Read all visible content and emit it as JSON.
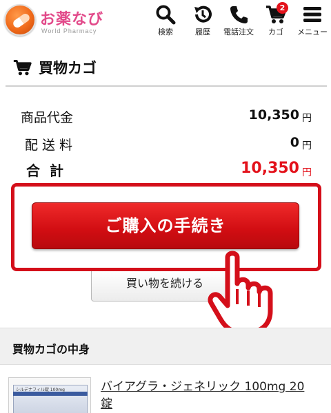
{
  "header": {
    "logo_title": "お薬なび",
    "logo_subtitle": "World Pharmacy",
    "nav": [
      {
        "label": "検索",
        "icon": "search-icon"
      },
      {
        "label": "履歴",
        "icon": "history-icon"
      },
      {
        "label": "電話注文",
        "icon": "phone-icon"
      },
      {
        "label": "カゴ",
        "icon": "cart-icon",
        "badge": "2"
      },
      {
        "label": "メニュー",
        "icon": "menu-icon"
      }
    ]
  },
  "page": {
    "title": "買物カゴ",
    "title_icon": "cart-icon"
  },
  "summary": {
    "subtotal_label": "商品代金",
    "subtotal_value": "10,350",
    "shipping_label": "配送料",
    "shipping_value": "0",
    "total_label": "合計",
    "total_value": "10,350",
    "currency_unit": "円"
  },
  "actions": {
    "checkout_label": "ご購入の手続き",
    "continue_label": "買い物を続ける",
    "pointer_icon": "hand-pointer-icon"
  },
  "contents": {
    "heading": "買物カゴの中身",
    "items": [
      {
        "name": "バイアグラ・ジェネリック 100mg 20 錠",
        "thumb_text": "シルデナフィル錠 100mg"
      }
    ]
  },
  "colors": {
    "accent_red": "#e3121b",
    "logo_pink": "#e24a8a",
    "logo_orange": "#f06a1a"
  }
}
